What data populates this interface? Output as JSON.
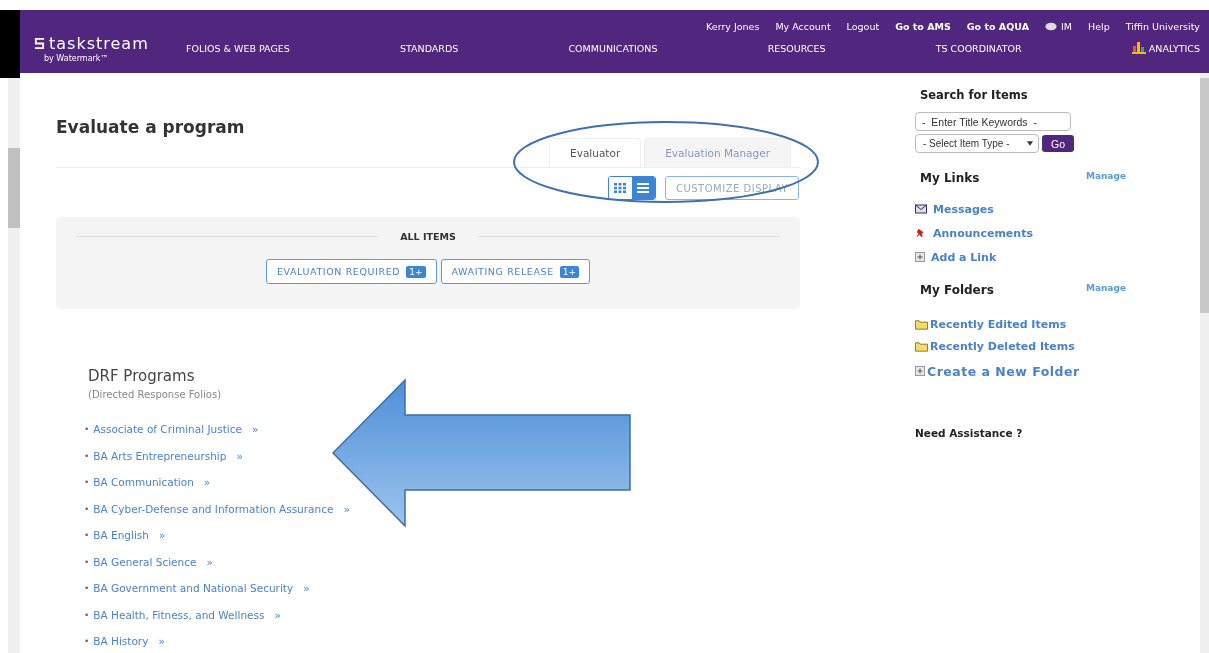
{
  "header": {
    "logo": "taskstream",
    "logo_sub": "by Watermark™",
    "user_links": [
      {
        "label": "Kerry Jones",
        "bold": false
      },
      {
        "label": "My Account",
        "bold": false
      },
      {
        "label": "Logout",
        "bold": false
      },
      {
        "label": "Go to AMS",
        "bold": true
      },
      {
        "label": "Go to AQUA",
        "bold": true
      },
      {
        "label": "IM",
        "bold": false,
        "kind": "chat"
      },
      {
        "label": "Help",
        "bold": false
      },
      {
        "label": "Tiffin University",
        "bold": false
      }
    ],
    "nav": [
      {
        "label": "FOLIOS & WEB PAGES"
      },
      {
        "label": "STANDARDS"
      },
      {
        "label": "COMMUNICATIONS"
      },
      {
        "label": "RESOURCES"
      },
      {
        "label": "TS COORDINATOR"
      },
      {
        "label": "ANALYTICS",
        "kind": "chart"
      }
    ]
  },
  "page_title": "Evaluate a program",
  "tabs": [
    {
      "label": "Evaluator",
      "selected": true
    },
    {
      "label": "Evaluation Manager",
      "selected": false
    }
  ],
  "view_toggle": [
    {
      "kind": "grid",
      "selected": false
    },
    {
      "kind": "list",
      "selected": true
    }
  ],
  "customize_button": "CUSTOMIZE DISPLAY",
  "filter_panel": {
    "heading": "ALL ITEMS",
    "filters": [
      {
        "label": "EVALUATION REQUIRED",
        "count": "1+"
      },
      {
        "label": "AWAITING RELEASE",
        "count": "1+"
      }
    ]
  },
  "programs": {
    "title": "DRF Programs",
    "subtitle": "(Directed Response Folios)",
    "marker": "•",
    "chevron": "»",
    "items": [
      "Associate of Criminal Justice",
      "BA Arts Entrepreneurship",
      "BA Communication",
      "BA Cyber-Defense and Information Assurance",
      "BA English",
      "BA General Science",
      "BA Government and National Security",
      "BA Health, Fitness, and Wellness",
      "BA History"
    ]
  },
  "sidebar": {
    "search_heading": "Search for Items",
    "keyword_placeholder": "-  Enter Title Keywords  -",
    "type_select": "- Select Item Type -",
    "go_button": "Go",
    "links_heading": "My Links",
    "links_manage": "Manage",
    "links": [
      {
        "label": "Messages",
        "kind": "mail"
      },
      {
        "label": "Announcements",
        "kind": "pin"
      },
      {
        "label": "Add a Link",
        "kind": "add"
      }
    ],
    "folders_heading": "My Folders",
    "folders_manage": "Manage",
    "folders": [
      {
        "label": "Recently Edited Items",
        "kind": "folder"
      },
      {
        "label": "Recently Deleted Items",
        "kind": "folder"
      },
      {
        "label": "Create a New Folder",
        "kind": "add"
      }
    ],
    "assistance": "Need Assistance ?"
  }
}
